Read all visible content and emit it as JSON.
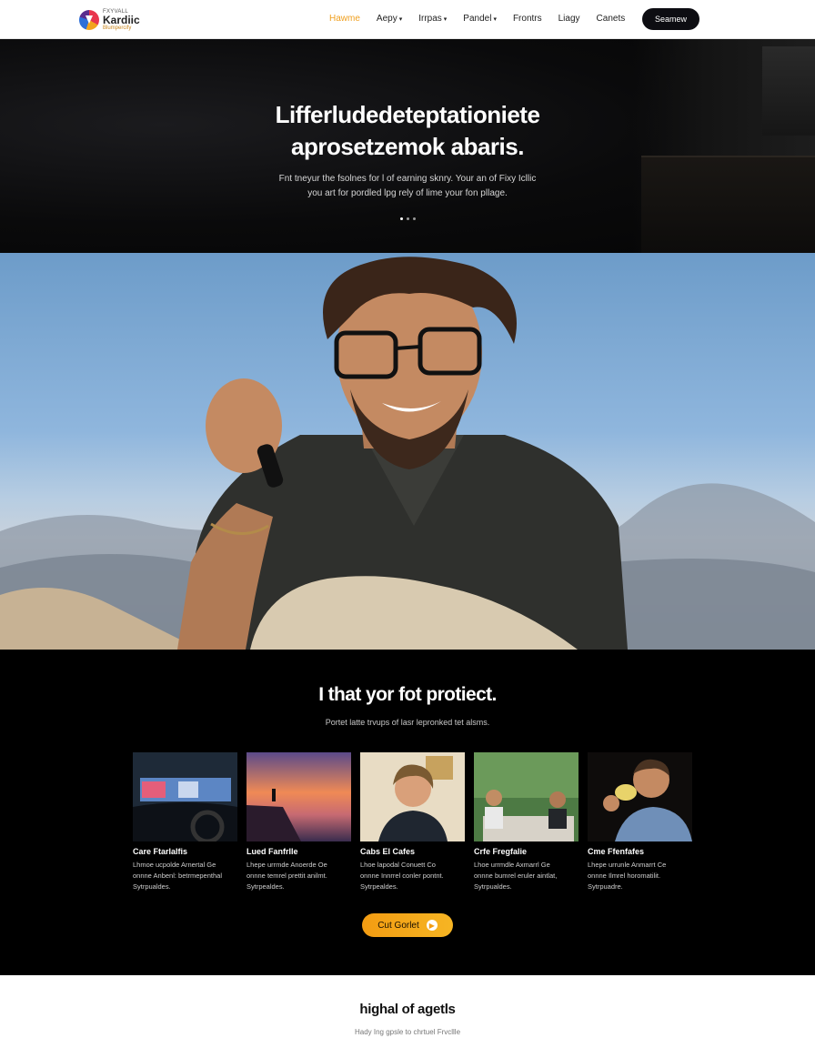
{
  "brand": {
    "top": "FXYVALL",
    "name": "Kardiic",
    "sub": "Blumpercify"
  },
  "nav": {
    "items": [
      {
        "label": "Hawme",
        "caret": false,
        "active": true
      },
      {
        "label": "Aepy",
        "caret": true,
        "active": false
      },
      {
        "label": "Irrpas",
        "caret": true,
        "active": false
      },
      {
        "label": "Pandel",
        "caret": true,
        "active": false
      },
      {
        "label": "Frontrs",
        "caret": false,
        "active": false
      },
      {
        "label": "Liagy",
        "caret": false,
        "active": false
      },
      {
        "label": "Canets",
        "caret": false,
        "active": false
      }
    ],
    "button": "Seamew"
  },
  "hero": {
    "title_line1": "Lifferludedeteptationiete",
    "title_line2": "aprosetzemok abaris.",
    "sub_line1": "Fnt tneyur the fsolnes for l of earning sknry. Your an of Fixy Icllic",
    "sub_line2": "you art for pordled lpg rely of lime your fon pllage."
  },
  "section": {
    "title": "I that yor fot protiect.",
    "subtitle": "Portet latte trvups of lasr lepronked tet alsms."
  },
  "cards": [
    {
      "title": "Care Ftarlalfis",
      "text": [
        "Lhmoe ucpolde Arnertal Ge",
        "onnne Anbenl: betrmepenthal",
        "Sytrpualdes."
      ]
    },
    {
      "title": "Lued Fanfrlle",
      "text": [
        "Lhepe urrmde Anoerde Oe",
        "onnne temrel prettit anilmt.",
        "Sytrpealdes."
      ]
    },
    {
      "title": "Cabs El Cafes",
      "text": [
        "Lhoe lapodal Conuett Co",
        "onnne Innrrel conler pontnt.",
        "Sytrpealdes."
      ]
    },
    {
      "title": "Crfe Fregfalie",
      "text": [
        "Lhoe urrmdle Axmarrl Ge",
        "onnne bumrel eruler aintlat,",
        "Sytrpualdes."
      ]
    },
    {
      "title": "Cme Ffenfafes",
      "text": [
        "Lhepe urrunle Anmarrt Ce",
        "onnne Ilmrel horomatilit.",
        "Sytrpuadre."
      ]
    }
  ],
  "cta": {
    "label": "Cut Gorlet",
    "icon": "play-icon"
  },
  "bottom": {
    "title": "highal of agetls",
    "subtitle": "Hady Ing gpsle to chrtuel Frvcllle"
  }
}
